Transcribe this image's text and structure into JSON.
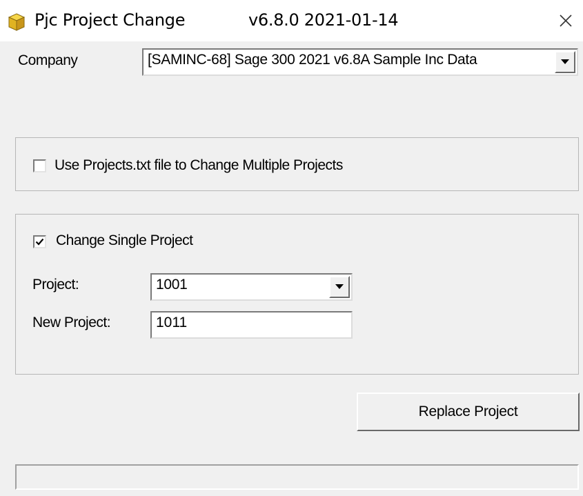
{
  "window": {
    "title": "Pjc Project Change",
    "version": "v6.8.0  2021-01-14",
    "icon": "package-cube-icon",
    "close_icon": "close-icon"
  },
  "company": {
    "label": "Company",
    "selected": "[SAMINC-68] Sage 300 2021 v6.8A Sample Inc Data"
  },
  "multiple_group": {
    "checkbox_label": "Use Projects.txt file to Change Multiple Projects",
    "checked": false
  },
  "single_group": {
    "checkbox_label": "Change Single Project",
    "checked": true,
    "project_label": "Project:",
    "project_value": "1001",
    "new_project_label": "New Project:",
    "new_project_value": "1011"
  },
  "actions": {
    "replace_label": "Replace Project"
  },
  "status": {
    "text": ""
  }
}
